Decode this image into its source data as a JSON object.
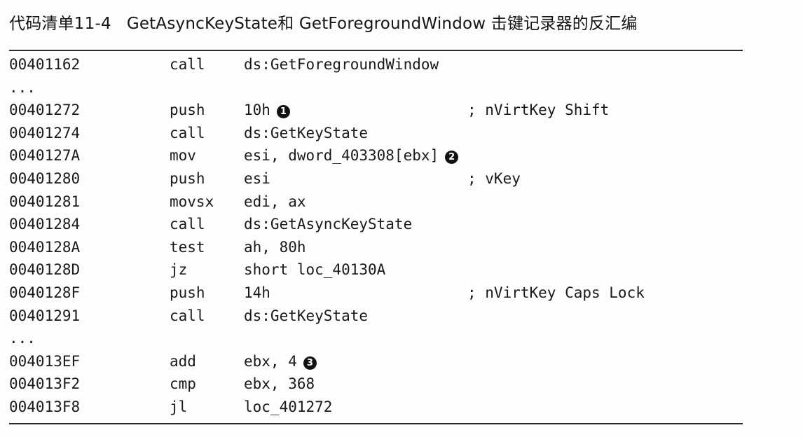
{
  "caption": {
    "label": "代码清单11-4",
    "title": "GetAsyncKeyState和 GetForegroundWindow 击键记录器的反汇编"
  },
  "listing": [
    {
      "addr": "00401162",
      "mnemonic": "call",
      "operands": "ds:GetForegroundWindow",
      "marker": "",
      "comment": ""
    },
    {
      "addr": "...",
      "mnemonic": "",
      "operands": "",
      "marker": "",
      "comment": ""
    },
    {
      "addr": "00401272",
      "mnemonic": "push",
      "operands": "10h",
      "marker": "1",
      "comment": "; nVirtKey Shift"
    },
    {
      "addr": "00401274",
      "mnemonic": "call",
      "operands": "ds:GetKeyState",
      "marker": "",
      "comment": ""
    },
    {
      "addr": "0040127A",
      "mnemonic": "mov",
      "operands": "esi, dword_403308[ebx]",
      "marker": "2",
      "comment": ""
    },
    {
      "addr": "00401280",
      "mnemonic": "push",
      "operands": "esi",
      "marker": "",
      "comment": "; vKey"
    },
    {
      "addr": "00401281",
      "mnemonic": "movsx",
      "operands": "edi, ax",
      "marker": "",
      "comment": ""
    },
    {
      "addr": "00401284",
      "mnemonic": "call",
      "operands": "ds:GetAsyncKeyState",
      "marker": "",
      "comment": ""
    },
    {
      "addr": "0040128A",
      "mnemonic": "test",
      "operands": "ah, 80h",
      "marker": "",
      "comment": ""
    },
    {
      "addr": "0040128D",
      "mnemonic": "jz",
      "operands": "short loc_40130A",
      "marker": "",
      "comment": ""
    },
    {
      "addr": "0040128F",
      "mnemonic": "push",
      "operands": "14h",
      "marker": "",
      "comment": "; nVirtKey Caps Lock"
    },
    {
      "addr": "00401291",
      "mnemonic": "call",
      "operands": "ds:GetKeyState",
      "marker": "",
      "comment": ""
    },
    {
      "addr": "...",
      "mnemonic": "",
      "operands": "",
      "marker": "",
      "comment": ""
    },
    {
      "addr": "004013EF",
      "mnemonic": "add",
      "operands": "ebx, 4",
      "marker": "3",
      "comment": ""
    },
    {
      "addr": "004013F2",
      "mnemonic": "cmp",
      "operands": "ebx, 368",
      "marker": "",
      "comment": ""
    },
    {
      "addr": "004013F8",
      "mnemonic": "jl",
      "operands": "loc_401272",
      "marker": "",
      "comment": ""
    }
  ]
}
